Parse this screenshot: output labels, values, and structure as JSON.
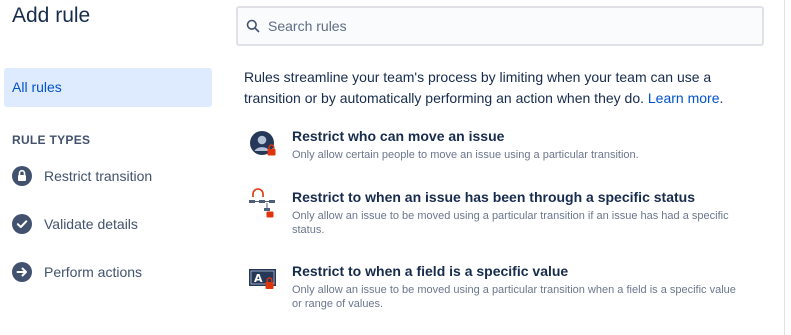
{
  "sidebar": {
    "title": "Add rule",
    "all_rules": "All rules",
    "section_label": "RULE TYPES",
    "items": [
      {
        "label": "Restrict transition",
        "icon": "lock-icon"
      },
      {
        "label": "Validate details",
        "icon": "check-circle-icon"
      },
      {
        "label": "Perform actions",
        "icon": "arrow-right-circle-icon"
      }
    ]
  },
  "search": {
    "placeholder": "Search rules",
    "value": ""
  },
  "intro": {
    "text": "Rules streamline your team's process by limiting when your team can use a transition or by automatically performing an action when they do.",
    "link": "Learn more",
    "period": "."
  },
  "rules": [
    {
      "title": "Restrict who can move an issue",
      "description": "Only allow certain people to move an issue using a particular transition.",
      "icon": "person-lock-icon"
    },
    {
      "title": "Restrict to when an issue has been through a specific status",
      "description": "Only allow an issue to be moved using a particular transition if an issue has had a specific status.",
      "icon": "workflow-lock-icon"
    },
    {
      "title": "Restrict to when a field is a specific value",
      "description": "Only allow an issue to be moved using a particular transition when a field is a specific value or range of values.",
      "icon": "field-lock-icon"
    }
  ],
  "colors": {
    "accent": "#0052cc",
    "selected_bg": "#deebff",
    "lock_red": "#de350b"
  }
}
